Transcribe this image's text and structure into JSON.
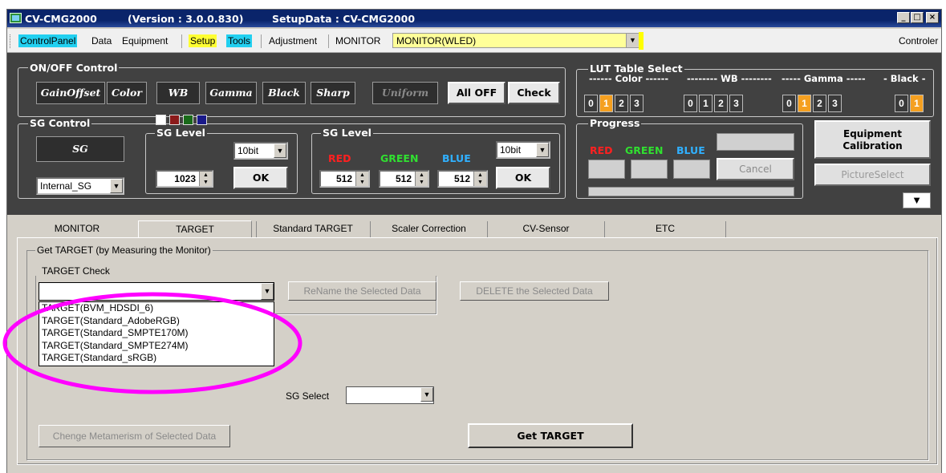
{
  "window": {
    "app": "CV-CMG2000",
    "version": "(Version : 3.0.0.830)",
    "setup": "SetupData : CV-CMG2000",
    "controls": [
      "_",
      "□",
      "×"
    ]
  },
  "menubar": {
    "items": [
      "ControlPanel",
      "Data",
      "Equipment",
      "Setup",
      "Tools",
      "Adjustment",
      "MONITOR"
    ],
    "monitor_value": "MONITOR(WLED)",
    "right_label": "Controler"
  },
  "onoff": {
    "title": "ON/OFF Control",
    "buttons": [
      "GainOffset",
      "Color",
      "WB",
      "Gamma",
      "Black",
      "Sharp",
      "Uniform"
    ],
    "all_off": "All OFF",
    "check": "Check"
  },
  "lut": {
    "title": "LUT Table Select",
    "color_label": "------ Color ------",
    "wb_label": "-------- WB --------",
    "gamma_label": "----- Gamma -----",
    "black_label": "- Black -",
    "color_vals": [
      "0",
      "1",
      "2",
      "3"
    ],
    "wb_vals": [
      "0",
      "1",
      "2",
      "3"
    ],
    "gamma_vals": [
      "0",
      "1",
      "2",
      "3"
    ],
    "black_vals": [
      "0",
      "1"
    ],
    "selected": {
      "color": 1,
      "wb": null,
      "gamma": 1,
      "black": 1
    },
    "on_color": "#f5a020"
  },
  "sg": {
    "title": "SG Control",
    "sg_button": "SG",
    "source": "Internal_SG",
    "level1_title": "SG Level",
    "bit1": "10bit",
    "level_value": "1023",
    "ok": "OK",
    "level2_title": "SG Level",
    "bit2": "10bit",
    "red_label": "RED",
    "green_label": "GREEN",
    "blue_label": "BLUE",
    "red_value": "512",
    "green_value": "512",
    "blue_value": "512"
  },
  "progress": {
    "title": "Progress",
    "red": "RED",
    "green": "GREEN",
    "blue": "BLUE",
    "cancel": "Cancel",
    "bar_fraction": 0
  },
  "side": {
    "equipment_calibration": "Equipment Calibration",
    "picture_select": "PictureSelect",
    "down_icon": "▼"
  },
  "tabs": [
    "MONITOR",
    "TARGET",
    "Standard TARGET",
    "Scaler Correction",
    "CV-Sensor",
    "ETC"
  ],
  "active_tab": "TARGET",
  "target": {
    "group_title": "Get TARGET (by Measuring the Monitor)",
    "check_label": "TARGET Check",
    "rename_button": "ReName the Selected Data",
    "delete_button": "DELETE the Selected Data",
    "options": [
      "TARGET(BVM_HDSDI_6)",
      "TARGET(Standard_AdobeRGB)",
      "TARGET(Standard_SMPTE170M)",
      "TARGET(Standard_SMPTE274M)",
      "TARGET(Standard_sRGB)"
    ],
    "sg_select_label": "SG Select",
    "metamerism_button": "Chenge Metamerism of Selected Data",
    "get_target_button": "Get TARGET"
  },
  "colors": {
    "title_bg": "#0a246a",
    "highlight_cyan": "#22d0f0",
    "highlight_yellow": "#ffff33",
    "annotation_ellipse": "#ff00ff",
    "red": "#ff2020",
    "green": "#30e030",
    "blue": "#30b0ff"
  }
}
